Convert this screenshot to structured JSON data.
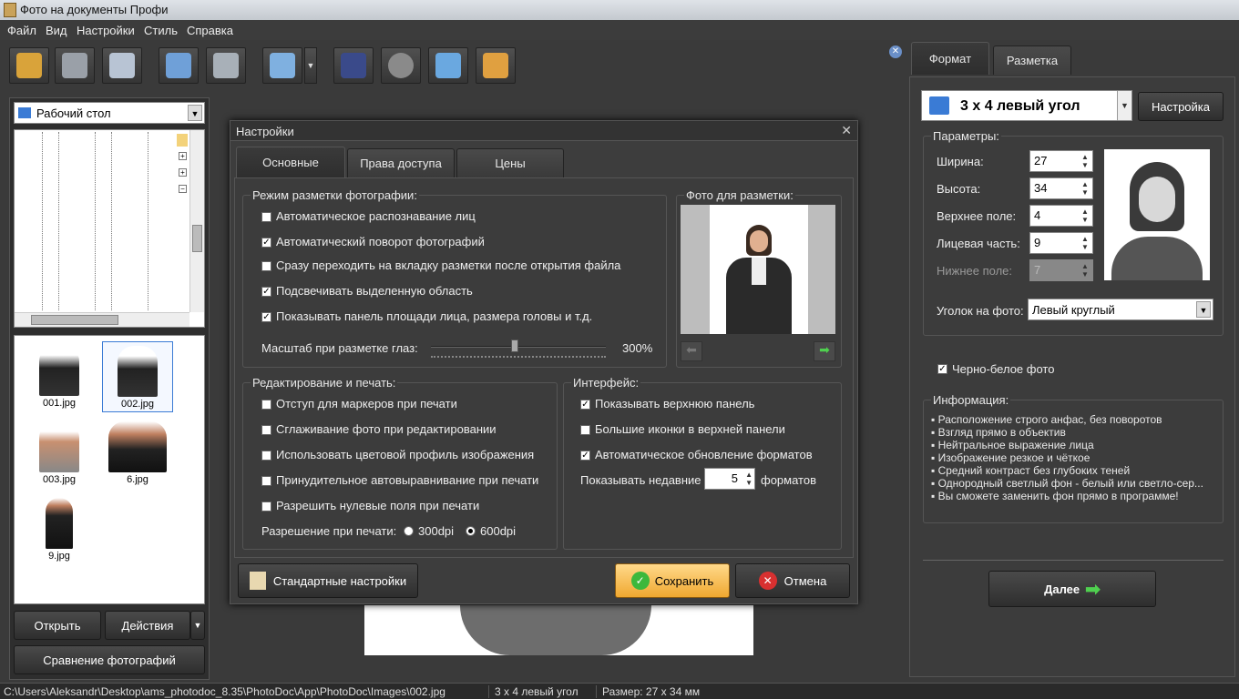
{
  "window": {
    "title": "Фото на документы Профи"
  },
  "menu": [
    "Файл",
    "Вид",
    "Настройки",
    "Стиль",
    "Справка"
  ],
  "toolbar": {
    "icons": [
      "open-folder-icon",
      "save-icon",
      "print-icon",
      "users-icon",
      "camera-icon",
      "monitor-icon",
      "help-book-icon",
      "film-icon",
      "home-icon",
      "cart-icon"
    ]
  },
  "left": {
    "folder": "Рабочий стол",
    "thumbs": [
      "001.jpg",
      "002.jpg",
      "003.jpg",
      "6.jpg",
      "9.jpg"
    ],
    "open_label": "Открыть",
    "actions_label": "Действия",
    "compare_label": "Сравнение фотографий"
  },
  "right": {
    "tab_format": "Формат",
    "tab_layout": "Разметка",
    "format_value": "3 x 4 левый угол",
    "settings_button": "Настройка",
    "params_title": "Параметры:",
    "width_label": "Ширина:",
    "width_value": "27",
    "height_label": "Высота:",
    "height_value": "34",
    "top_label": "Верхнее поле:",
    "top_value": "4",
    "face_label": "Лицевая часть:",
    "face_value": "9",
    "bottom_label": "Нижнее поле:",
    "bottom_value": "7",
    "corner_label": "Уголок на фото:",
    "corner_value": "Левый круглый",
    "bw_label": "Черно-белое фото",
    "info_title": "Информация:",
    "info": [
      "Расположение строго анфас, без поворотов",
      "Взгляд прямо в объектив",
      "Нейтральное выражение лица",
      "Изображение резкое и чёткое",
      "Средний контраст без глубоких теней",
      "Однородный светлый фон - белый или светло-сер...",
      "Вы сможете заменить фон прямо в программе!"
    ],
    "next_label": "Далее"
  },
  "dialog": {
    "title": "Настройки",
    "tabs": [
      "Основные",
      "Права доступа",
      "Цены"
    ],
    "markup_group": "Режим разметки фотографии:",
    "markup_opts": [
      {
        "label": "Автоматическое распознавание лиц",
        "checked": false
      },
      {
        "label": "Автоматический поворот фотографий",
        "checked": true
      },
      {
        "label": "Сразу переходить на вкладку разметки после открытия файла",
        "checked": false
      },
      {
        "label": "Подсвечивать выделенную область",
        "checked": true
      },
      {
        "label": "Показывать панель площади лица, размера головы и т.д.",
        "checked": true
      }
    ],
    "eye_scale_label": "Масштаб при разметке глаз:",
    "eye_scale_value": "300%",
    "eye_scale_fraction": 0.48,
    "photo_group": "Фото для разметки:",
    "edit_group": "Редактирование и печать:",
    "edit_opts": [
      {
        "label": "Отступ для маркеров при печати",
        "checked": false
      },
      {
        "label": "Сглаживание фото при редактировании",
        "checked": false
      },
      {
        "label": "Использовать цветовой профиль изображения",
        "checked": false
      },
      {
        "label": "Принудительное автовыравнивание при печати",
        "checked": false
      },
      {
        "label": "Разрешить нулевые поля при печати",
        "checked": false
      }
    ],
    "resolution_label": "Разрешение при печати:",
    "res_300": "300dpi",
    "res_600": "600dpi",
    "iface_group": "Интерфейс:",
    "iface_opts": [
      {
        "label": "Показывать верхнюю панель",
        "checked": true
      },
      {
        "label": "Большие иконки в верхней панели",
        "checked": false
      },
      {
        "label": "Автоматическое обновление форматов",
        "checked": true
      }
    ],
    "recent_label": "Показывать недавние",
    "recent_value": "5",
    "recent_suffix": "форматов",
    "defaults_button": "Стандартные настройки",
    "save_button": "Сохранить",
    "cancel_button": "Отмена"
  },
  "status": {
    "path": "C:\\Users\\Aleksandr\\Desktop\\ams_photodoc_8.35\\PhotoDoc\\App\\PhotoDoc\\Images\\002.jpg",
    "format": "3 x 4 левый угол",
    "size": "Размер: 27 x 34 мм"
  }
}
